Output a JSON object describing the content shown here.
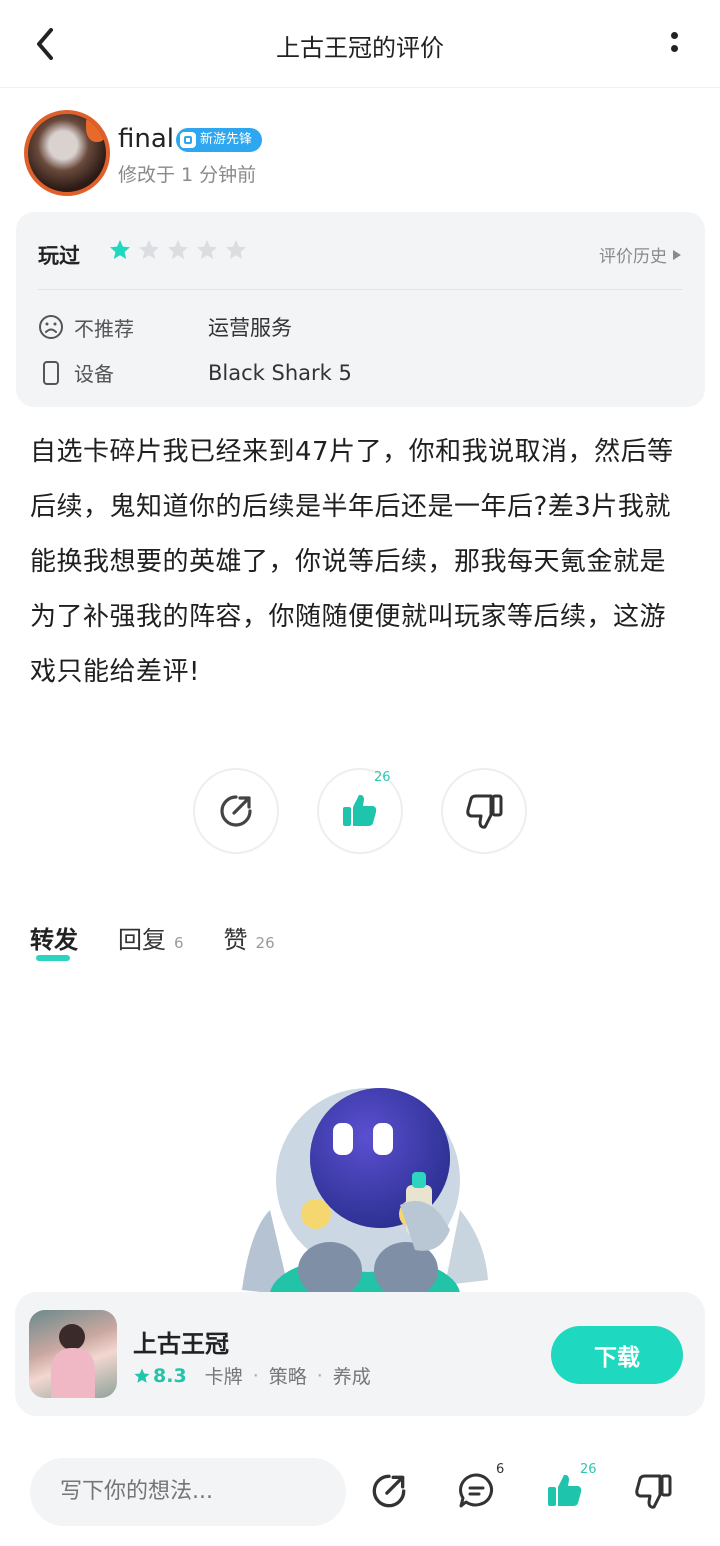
{
  "header": {
    "title": "上古王冠的评价"
  },
  "author": {
    "name": "final",
    "badge": "新游先锋",
    "modified": "修改于 1 分钟前"
  },
  "rating": {
    "played_label": "玩过",
    "stars_filled": 1,
    "stars_total": 5,
    "history_label": "评价历史",
    "tag_icon": "frown-icon",
    "tag_label": "不推荐",
    "tag_value": "运营服务",
    "device_label": "设备",
    "device_value": "Black Shark 5"
  },
  "review": {
    "text": "自选卡碎片我已经来到47片了，你和我说取消，然后等后续，鬼知道你的后续是半年后还是一年后?差3片我就能换我想要的英雄了，你说等后续，那我每天氪金就是为了补强我的阵容，你随随便便就叫玩家等后续，这游戏只能给差评!"
  },
  "actions": {
    "like_count": "26"
  },
  "tabs": [
    {
      "label": "转发",
      "count": ""
    },
    {
      "label": "回复",
      "count": "6"
    },
    {
      "label": "赞",
      "count": "26"
    }
  ],
  "game": {
    "name": "上古王冠",
    "score": "8.3",
    "tags": [
      "卡牌",
      "策略",
      "养成"
    ],
    "download_label": "下载"
  },
  "bottom": {
    "placeholder": "写下你的想法...",
    "reply_count": "6",
    "like_count": "26"
  },
  "colors": {
    "accent": "#1ed8bf",
    "badge": "#2fa7f0"
  }
}
